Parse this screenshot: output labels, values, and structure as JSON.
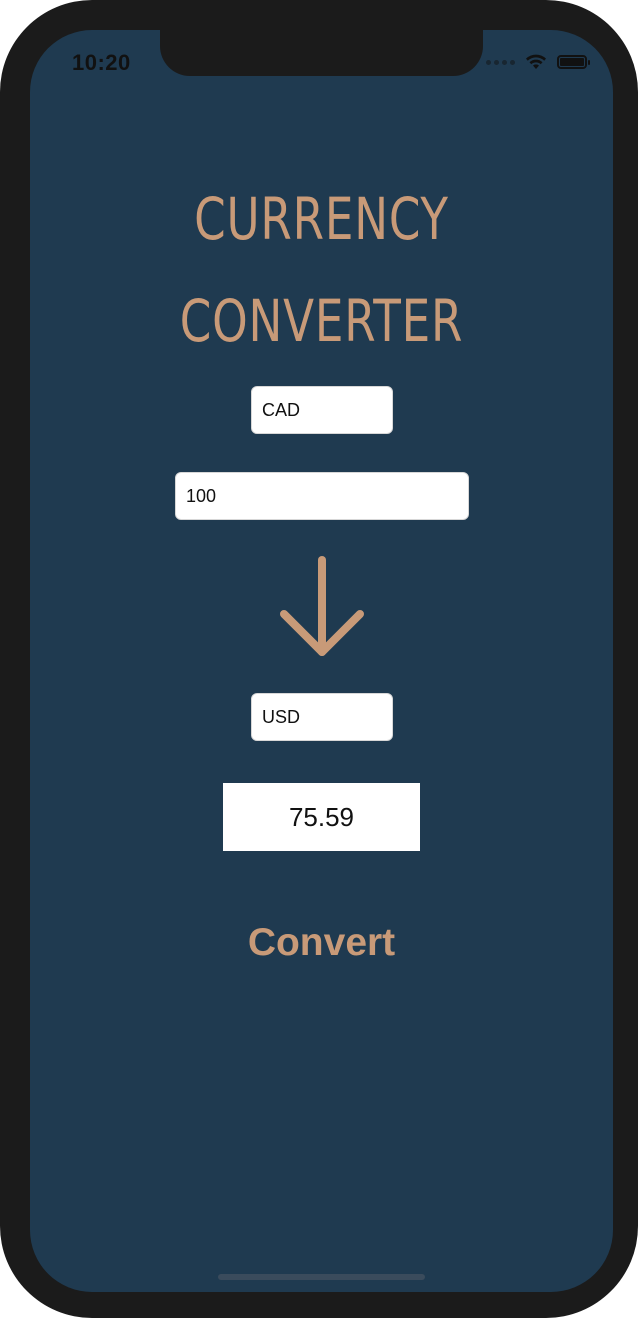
{
  "status_bar": {
    "time": "10:20",
    "icons": [
      "signal-dots-icon",
      "wifi-icon",
      "battery-icon"
    ]
  },
  "title": {
    "line1": "CURRENCY",
    "line2": "CONVERTER"
  },
  "form": {
    "from_currency": "CAD",
    "amount": "100",
    "to_currency": "USD"
  },
  "result": {
    "value": "75.59"
  },
  "actions": {
    "convert_label": "Convert"
  },
  "colors": {
    "background": "#1f3a50",
    "accent": "#c89a78",
    "field": "#ffffff"
  }
}
